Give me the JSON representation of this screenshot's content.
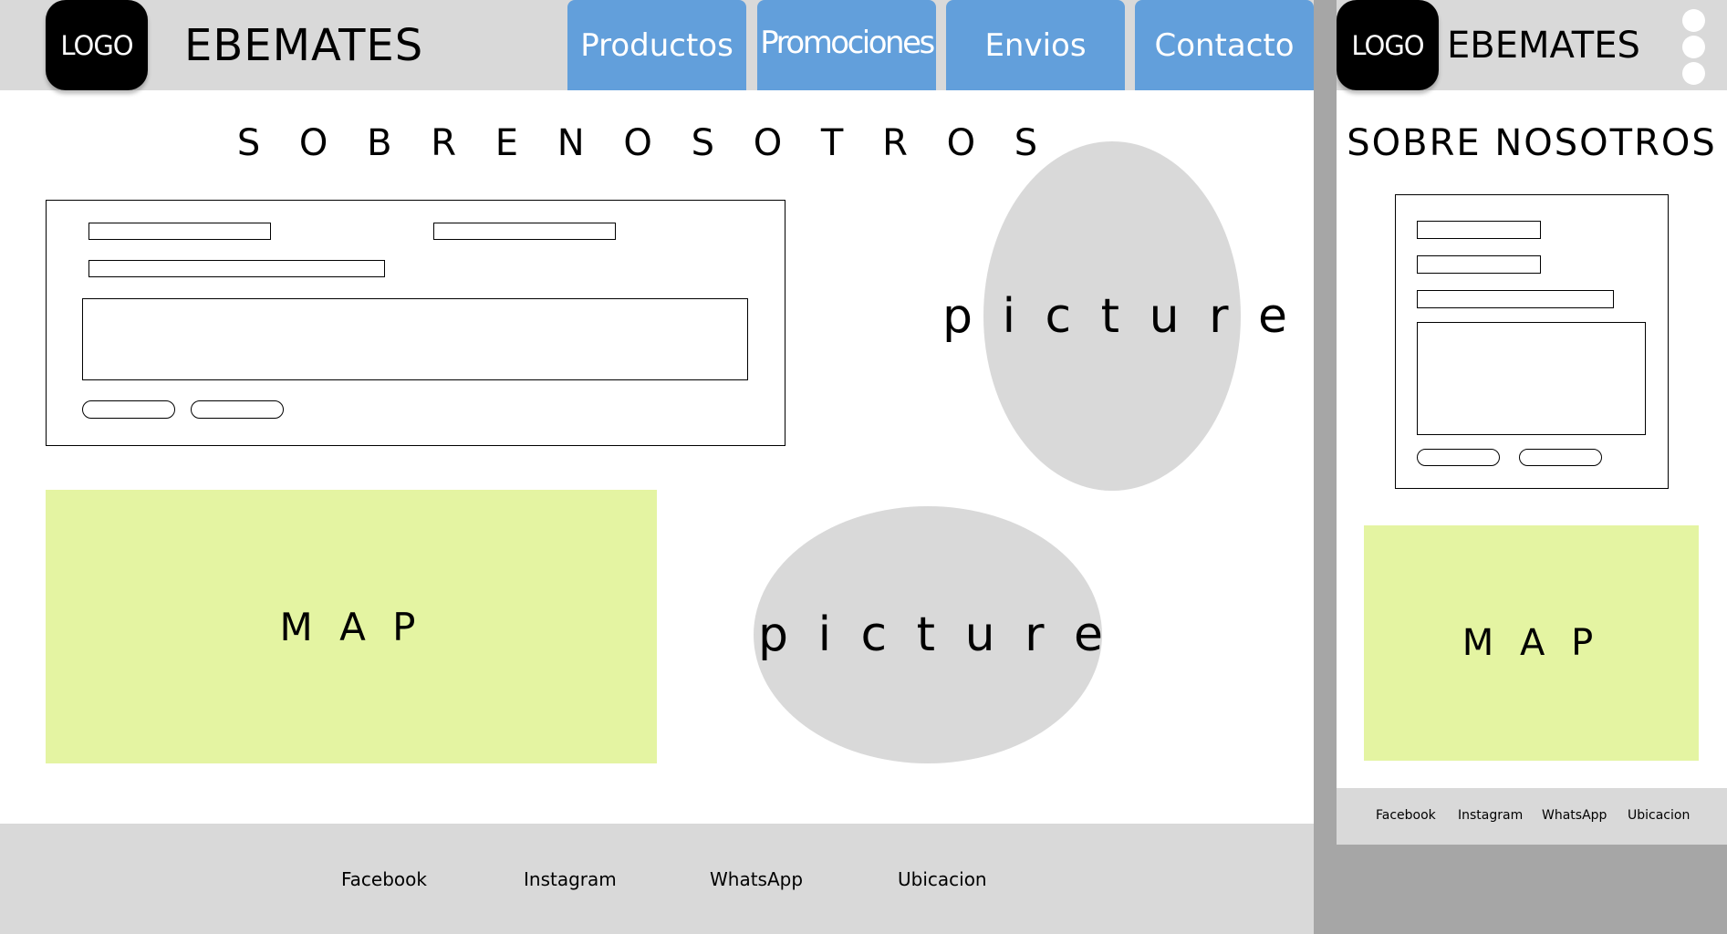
{
  "desktop": {
    "header": {
      "logo_label": "LOGO",
      "brand": "EBEMATES",
      "nav": [
        {
          "label": "Productos"
        },
        {
          "label": "Promociones"
        },
        {
          "label": "Envios"
        },
        {
          "label": "Contacto"
        }
      ]
    },
    "section_title": "S O B R E   N O S O T R O S",
    "pictures": [
      {
        "label": "p i c t u r e"
      },
      {
        "label": "p i c t u r e"
      }
    ],
    "map_label": "M A P",
    "footer": {
      "links": [
        "Facebook",
        "Instagram",
        "WhatsApp",
        "Ubicacion"
      ]
    }
  },
  "mobile": {
    "header": {
      "logo_label": "LOGO",
      "brand": "EBEMATES"
    },
    "section_title": "SOBRE NOSOTROS",
    "map_label": "M A P",
    "footer": {
      "links": [
        "Facebook",
        "Instagram",
        "WhatsApp",
        "Ubicacion"
      ]
    }
  },
  "colors": {
    "header_bg": "#d9d9d9",
    "nav_accent": "#629fdb",
    "map_bg": "#e4f4a2",
    "picture_bg": "#d9d9d9",
    "canvas_bg": "#a6a6a6"
  }
}
